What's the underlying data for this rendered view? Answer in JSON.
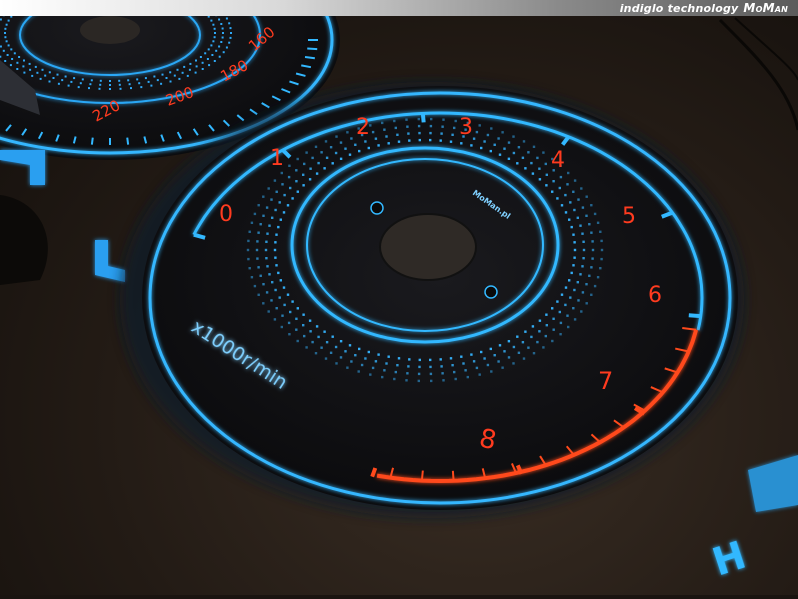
{
  "banner": {
    "tagline": "indiglo technology",
    "brand_logo": "MoMan"
  },
  "tachometer": {
    "numerals": [
      "0",
      "1",
      "2",
      "3",
      "4",
      "5",
      "6",
      "7",
      "8"
    ],
    "unit_label": "x1000r/min",
    "maker_mark": "MoMan.pl",
    "redline_numerals": [
      "6",
      "7",
      "8"
    ],
    "colors": {
      "glow_blue": "#33b8ff",
      "numeral_red": "#ff3b1f",
      "redzone": "#ff4a1c",
      "face": "#0e0e10"
    }
  },
  "speedometer": {
    "numerals": [
      "160",
      "180",
      "200",
      "220"
    ]
  },
  "corner_letter": "H"
}
